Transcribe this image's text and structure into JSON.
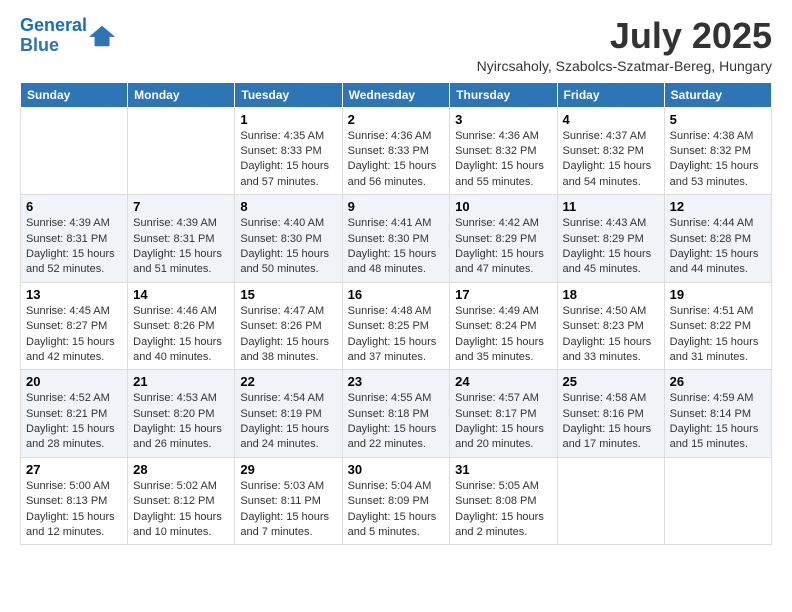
{
  "header": {
    "logo_line1": "General",
    "logo_line2": "Blue",
    "month": "July 2025",
    "location": "Nyircsaholy, Szabolcs-Szatmar-Bereg, Hungary"
  },
  "weekdays": [
    "Sunday",
    "Monday",
    "Tuesday",
    "Wednesday",
    "Thursday",
    "Friday",
    "Saturday"
  ],
  "weeks": [
    [
      {
        "day": "",
        "info": ""
      },
      {
        "day": "",
        "info": ""
      },
      {
        "day": "1",
        "info": "Sunrise: 4:35 AM\nSunset: 8:33 PM\nDaylight: 15 hours and 57 minutes."
      },
      {
        "day": "2",
        "info": "Sunrise: 4:36 AM\nSunset: 8:33 PM\nDaylight: 15 hours and 56 minutes."
      },
      {
        "day": "3",
        "info": "Sunrise: 4:36 AM\nSunset: 8:32 PM\nDaylight: 15 hours and 55 minutes."
      },
      {
        "day": "4",
        "info": "Sunrise: 4:37 AM\nSunset: 8:32 PM\nDaylight: 15 hours and 54 minutes."
      },
      {
        "day": "5",
        "info": "Sunrise: 4:38 AM\nSunset: 8:32 PM\nDaylight: 15 hours and 53 minutes."
      }
    ],
    [
      {
        "day": "6",
        "info": "Sunrise: 4:39 AM\nSunset: 8:31 PM\nDaylight: 15 hours and 52 minutes."
      },
      {
        "day": "7",
        "info": "Sunrise: 4:39 AM\nSunset: 8:31 PM\nDaylight: 15 hours and 51 minutes."
      },
      {
        "day": "8",
        "info": "Sunrise: 4:40 AM\nSunset: 8:30 PM\nDaylight: 15 hours and 50 minutes."
      },
      {
        "day": "9",
        "info": "Sunrise: 4:41 AM\nSunset: 8:30 PM\nDaylight: 15 hours and 48 minutes."
      },
      {
        "day": "10",
        "info": "Sunrise: 4:42 AM\nSunset: 8:29 PM\nDaylight: 15 hours and 47 minutes."
      },
      {
        "day": "11",
        "info": "Sunrise: 4:43 AM\nSunset: 8:29 PM\nDaylight: 15 hours and 45 minutes."
      },
      {
        "day": "12",
        "info": "Sunrise: 4:44 AM\nSunset: 8:28 PM\nDaylight: 15 hours and 44 minutes."
      }
    ],
    [
      {
        "day": "13",
        "info": "Sunrise: 4:45 AM\nSunset: 8:27 PM\nDaylight: 15 hours and 42 minutes."
      },
      {
        "day": "14",
        "info": "Sunrise: 4:46 AM\nSunset: 8:26 PM\nDaylight: 15 hours and 40 minutes."
      },
      {
        "day": "15",
        "info": "Sunrise: 4:47 AM\nSunset: 8:26 PM\nDaylight: 15 hours and 38 minutes."
      },
      {
        "day": "16",
        "info": "Sunrise: 4:48 AM\nSunset: 8:25 PM\nDaylight: 15 hours and 37 minutes."
      },
      {
        "day": "17",
        "info": "Sunrise: 4:49 AM\nSunset: 8:24 PM\nDaylight: 15 hours and 35 minutes."
      },
      {
        "day": "18",
        "info": "Sunrise: 4:50 AM\nSunset: 8:23 PM\nDaylight: 15 hours and 33 minutes."
      },
      {
        "day": "19",
        "info": "Sunrise: 4:51 AM\nSunset: 8:22 PM\nDaylight: 15 hours and 31 minutes."
      }
    ],
    [
      {
        "day": "20",
        "info": "Sunrise: 4:52 AM\nSunset: 8:21 PM\nDaylight: 15 hours and 28 minutes."
      },
      {
        "day": "21",
        "info": "Sunrise: 4:53 AM\nSunset: 8:20 PM\nDaylight: 15 hours and 26 minutes."
      },
      {
        "day": "22",
        "info": "Sunrise: 4:54 AM\nSunset: 8:19 PM\nDaylight: 15 hours and 24 minutes."
      },
      {
        "day": "23",
        "info": "Sunrise: 4:55 AM\nSunset: 8:18 PM\nDaylight: 15 hours and 22 minutes."
      },
      {
        "day": "24",
        "info": "Sunrise: 4:57 AM\nSunset: 8:17 PM\nDaylight: 15 hours and 20 minutes."
      },
      {
        "day": "25",
        "info": "Sunrise: 4:58 AM\nSunset: 8:16 PM\nDaylight: 15 hours and 17 minutes."
      },
      {
        "day": "26",
        "info": "Sunrise: 4:59 AM\nSunset: 8:14 PM\nDaylight: 15 hours and 15 minutes."
      }
    ],
    [
      {
        "day": "27",
        "info": "Sunrise: 5:00 AM\nSunset: 8:13 PM\nDaylight: 15 hours and 12 minutes."
      },
      {
        "day": "28",
        "info": "Sunrise: 5:02 AM\nSunset: 8:12 PM\nDaylight: 15 hours and 10 minutes."
      },
      {
        "day": "29",
        "info": "Sunrise: 5:03 AM\nSunset: 8:11 PM\nDaylight: 15 hours and 7 minutes."
      },
      {
        "day": "30",
        "info": "Sunrise: 5:04 AM\nSunset: 8:09 PM\nDaylight: 15 hours and 5 minutes."
      },
      {
        "day": "31",
        "info": "Sunrise: 5:05 AM\nSunset: 8:08 PM\nDaylight: 15 hours and 2 minutes."
      },
      {
        "day": "",
        "info": ""
      },
      {
        "day": "",
        "info": ""
      }
    ]
  ]
}
